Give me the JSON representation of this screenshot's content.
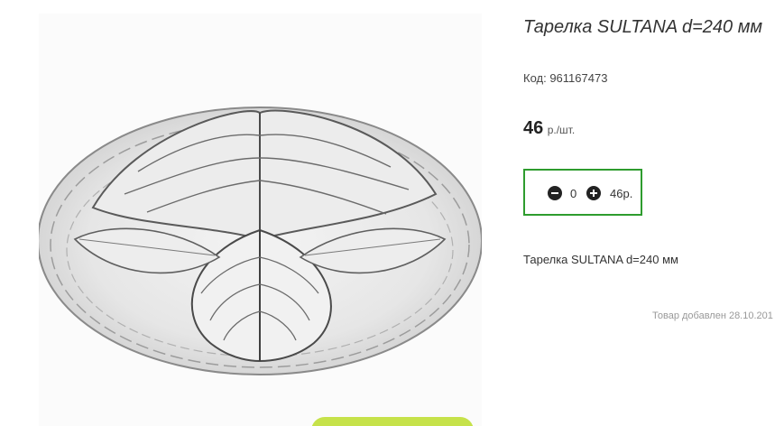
{
  "product": {
    "title": "Тарелка SULTANA d=240 мм",
    "code": "Код: 961167473",
    "price_value": "46",
    "price_unit": "р./шт.",
    "description": "Тарелка SULTANA d=240 мм",
    "added": "Товар добавлен 28.10.201"
  },
  "quantity": {
    "value": "0",
    "total": "46р."
  },
  "image": {
    "subject": "glass leaf-pattern plate",
    "decrement_icon": "minus-circle-icon",
    "increment_icon": "plus-circle-icon"
  },
  "colors": {
    "accent_border": "#2e9c2e",
    "cart_button": "#c6e24a"
  }
}
